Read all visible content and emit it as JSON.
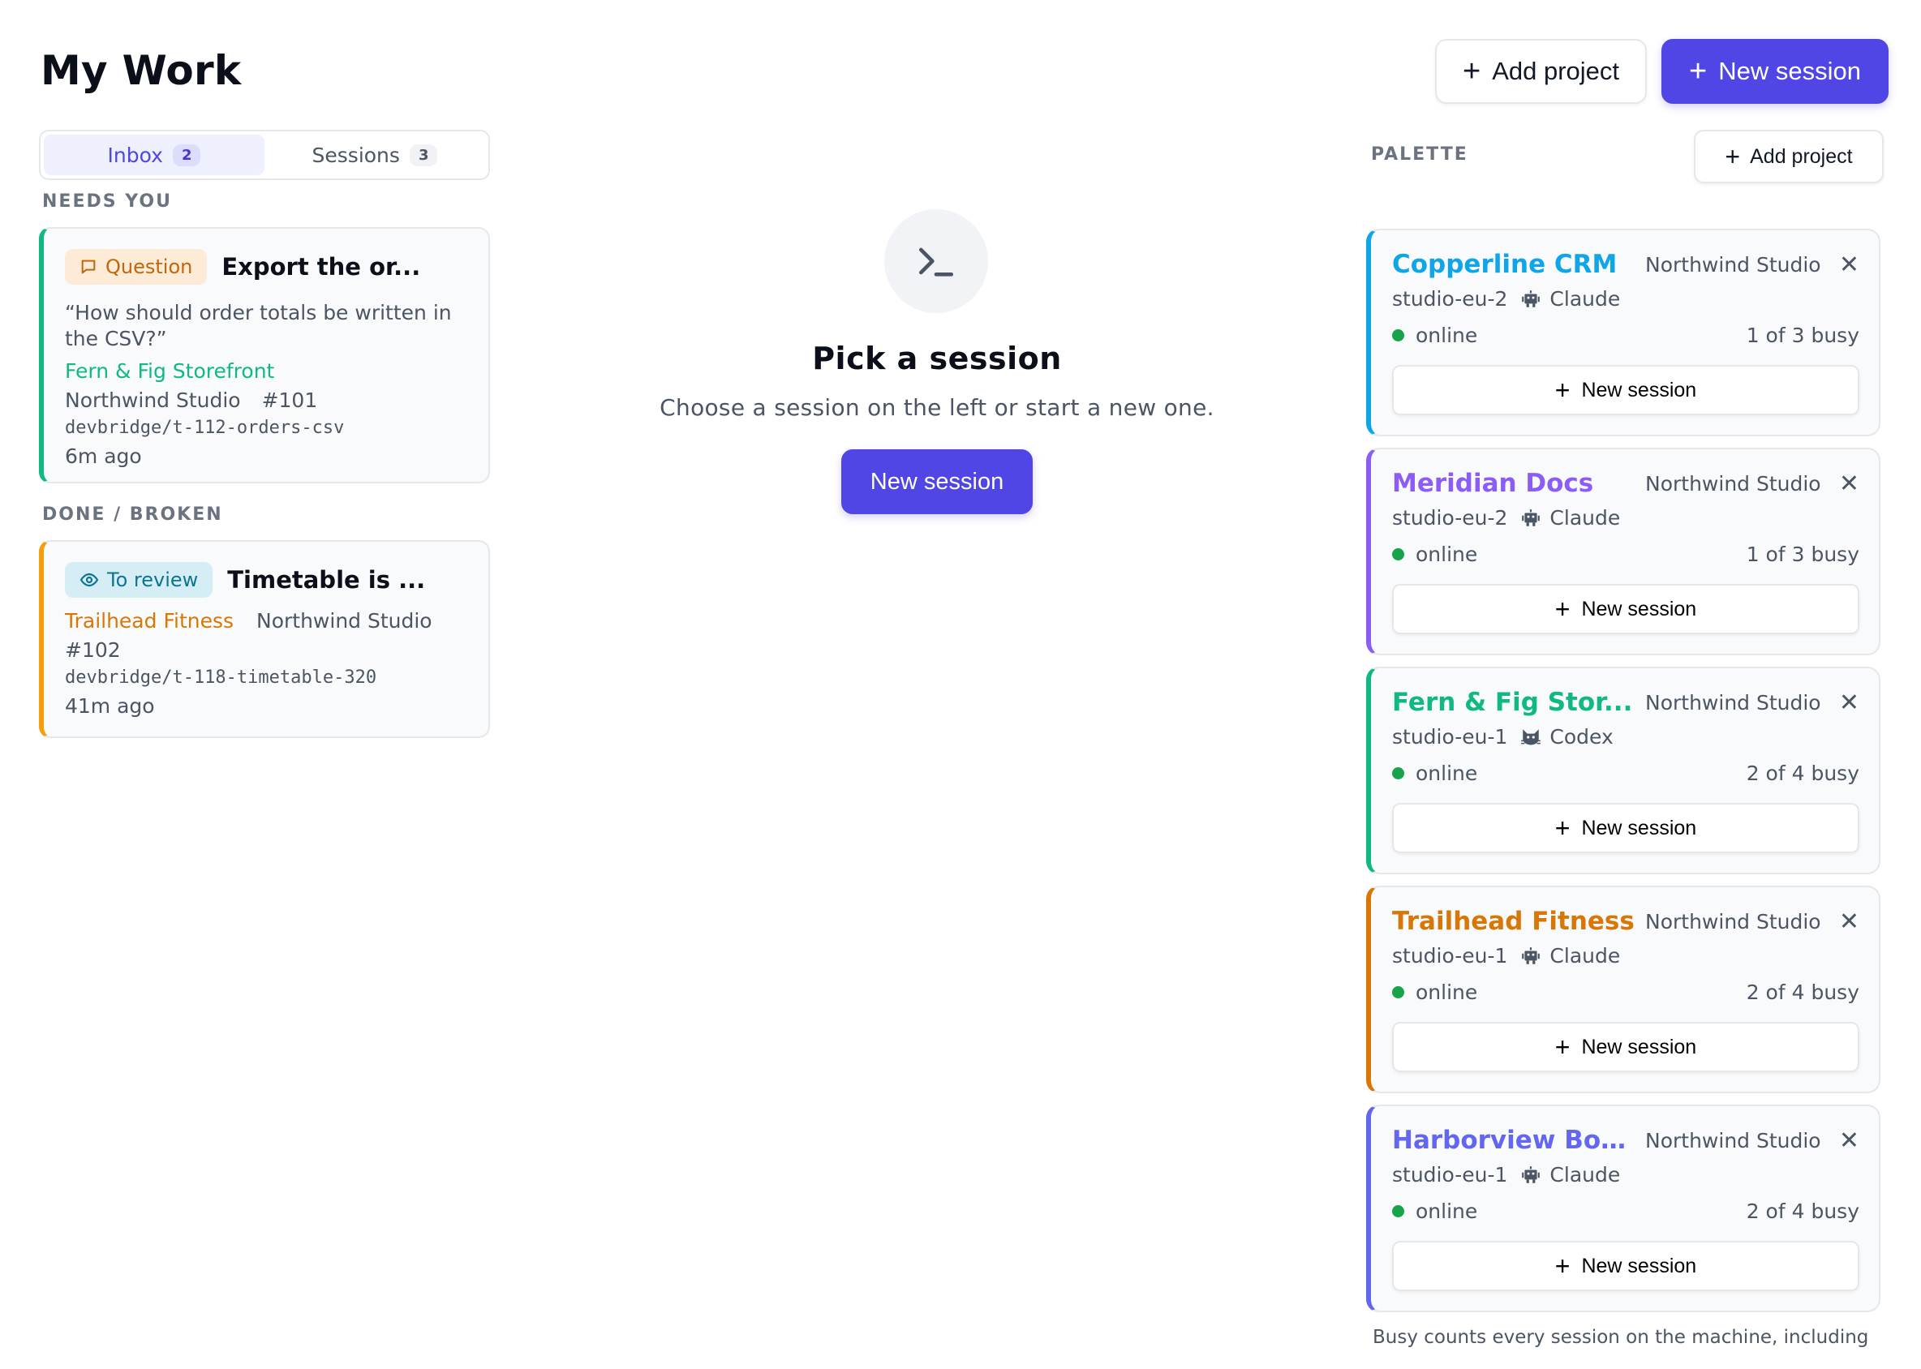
{
  "header": {
    "title": "My Work",
    "add_project_label": "Add project",
    "new_session_label": "New session"
  },
  "tabs": [
    {
      "label": "Inbox",
      "count": "2",
      "active": true
    },
    {
      "label": "Sessions",
      "count": "3",
      "active": false
    }
  ],
  "sections": {
    "needs_you": "NEEDS YOU",
    "done_broken": "DONE / BROKEN"
  },
  "inbox": [
    {
      "tag": "Question",
      "title": "Export the or...",
      "quote": "“How should order totals be written in the CSV?”",
      "project": "Fern & Fig Storefront",
      "project_color": "#10b981",
      "org": "Northwind Studio",
      "ticket": "#101",
      "branch": "devbridge/t-112-orders-csv",
      "ago": "6m ago"
    },
    {
      "tag": "To review",
      "title": "Timetable is ...",
      "project": "Trailhead Fitness",
      "project_color": "#d97706",
      "org": "Northwind Studio",
      "ticket": "#102",
      "branch": "devbridge/t-118-timetable-320",
      "ago": "41m ago"
    }
  ],
  "center": {
    "title": "Pick a session",
    "subtitle": "Choose a session on the left or start a new one.",
    "button_label": "New session"
  },
  "palette": {
    "label": "PALETTE",
    "add_project_label": "Add project",
    "projects": [
      {
        "name": "Copperline CRM",
        "color": "#0ea5e9",
        "org": "Northwind Studio",
        "host": "studio-eu-2",
        "agent": "Claude",
        "agent_icon": "robot-icon",
        "status": "online",
        "busy": "1 of 3 busy",
        "new_session_label": "New session"
      },
      {
        "name": "Meridian Docs",
        "color": "#8b5cf6",
        "org": "Northwind Studio",
        "host": "studio-eu-2",
        "agent": "Claude",
        "agent_icon": "robot-icon",
        "status": "online",
        "busy": "1 of 3 busy",
        "new_session_label": "New session"
      },
      {
        "name": "Fern & Fig Stor...",
        "color": "#10b981",
        "org": "Northwind Studio",
        "host": "studio-eu-1",
        "agent": "Codex",
        "agent_icon": "cat-icon",
        "status": "online",
        "busy": "2 of 4 busy",
        "new_session_label": "New session"
      },
      {
        "name": "Trailhead Fitness",
        "color": "#d97706",
        "org": "Northwind Studio",
        "host": "studio-eu-1",
        "agent": "Claude",
        "agent_icon": "robot-icon",
        "status": "online",
        "busy": "2 of 4 busy",
        "new_session_label": "New session"
      },
      {
        "name": "Harborview Boo...",
        "color": "#6366f1",
        "org": "Northwind Studio",
        "host": "studio-eu-1",
        "agent": "Claude",
        "agent_icon": "robot-icon",
        "status": "online",
        "busy": "2 of 4 busy",
        "new_session_label": "New session"
      }
    ],
    "footnote": "Busy counts every session on the machine, including"
  }
}
